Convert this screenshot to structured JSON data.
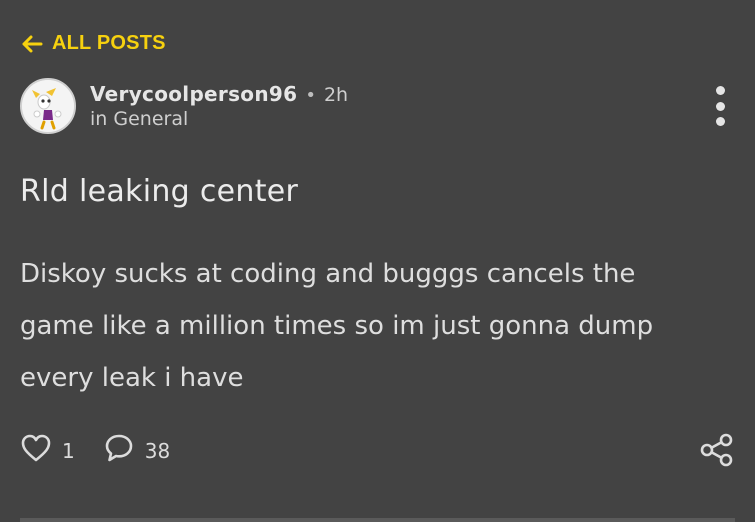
{
  "nav": {
    "back_label": "ALL POSTS",
    "back_icon": "arrow-left-icon",
    "accent_color": "#f6d10f"
  },
  "post": {
    "author": "Verycoolperson96",
    "separator": "•",
    "time": "2h",
    "category": "in General",
    "title": "Rld leaking center",
    "body_lines": [
      "Diskoy sucks at coding and bugggs cancels the",
      "game like a million times so im just gonna dump",
      "every leak i have"
    ],
    "likes": "1",
    "comments": "38"
  },
  "icons": {
    "like": "heart-icon",
    "comment": "comment-icon",
    "share": "share-icon",
    "menu": "more-vertical-icon"
  }
}
